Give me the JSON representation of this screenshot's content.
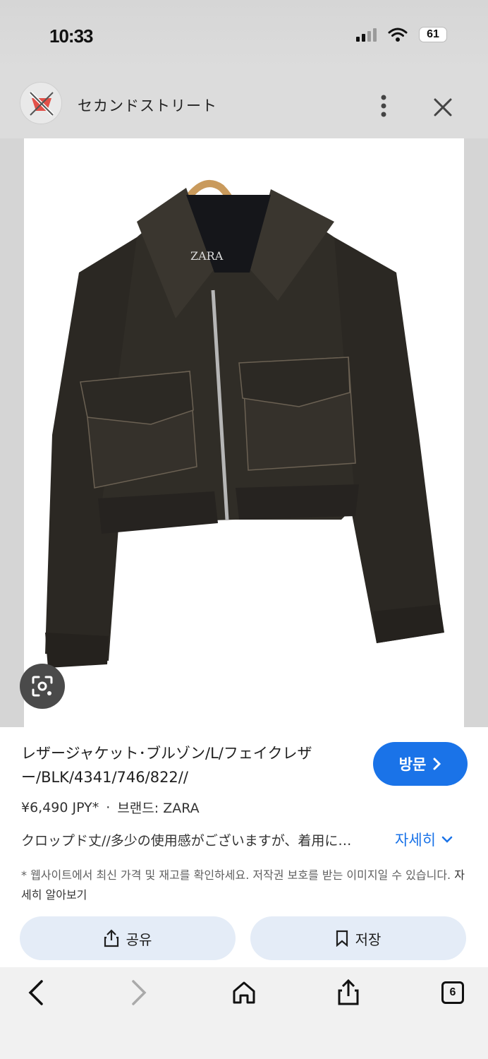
{
  "status_bar": {
    "time": "10:33",
    "battery": "61"
  },
  "source": {
    "name": "セカンドストリート"
  },
  "product": {
    "title": "レザージャケット･ブルゾン/L/フェイクレザー/BLK/4341/746/822//",
    "price": "¥6,490 JPY*",
    "separator": "·",
    "brand": "브랜드: ZARA",
    "description": "クロップド丈//多少の使用感がございますが、着用に…",
    "more_label": "자세히",
    "disclaimer": "* 웹사이트에서 최신 가격 및 재고를 확인하세요. 저작권 보호를 받는 이미지일 수 있습니다.",
    "learn_more": "자세히 알아보기",
    "visit_label": "방문",
    "image_brand_tag": "ZARA"
  },
  "actions": {
    "share_label": "공유",
    "save_label": "저장"
  },
  "toolbar": {
    "tab_count": "6"
  },
  "colors": {
    "accent": "#1a73e8",
    "action_bg": "#e4ecf7"
  }
}
